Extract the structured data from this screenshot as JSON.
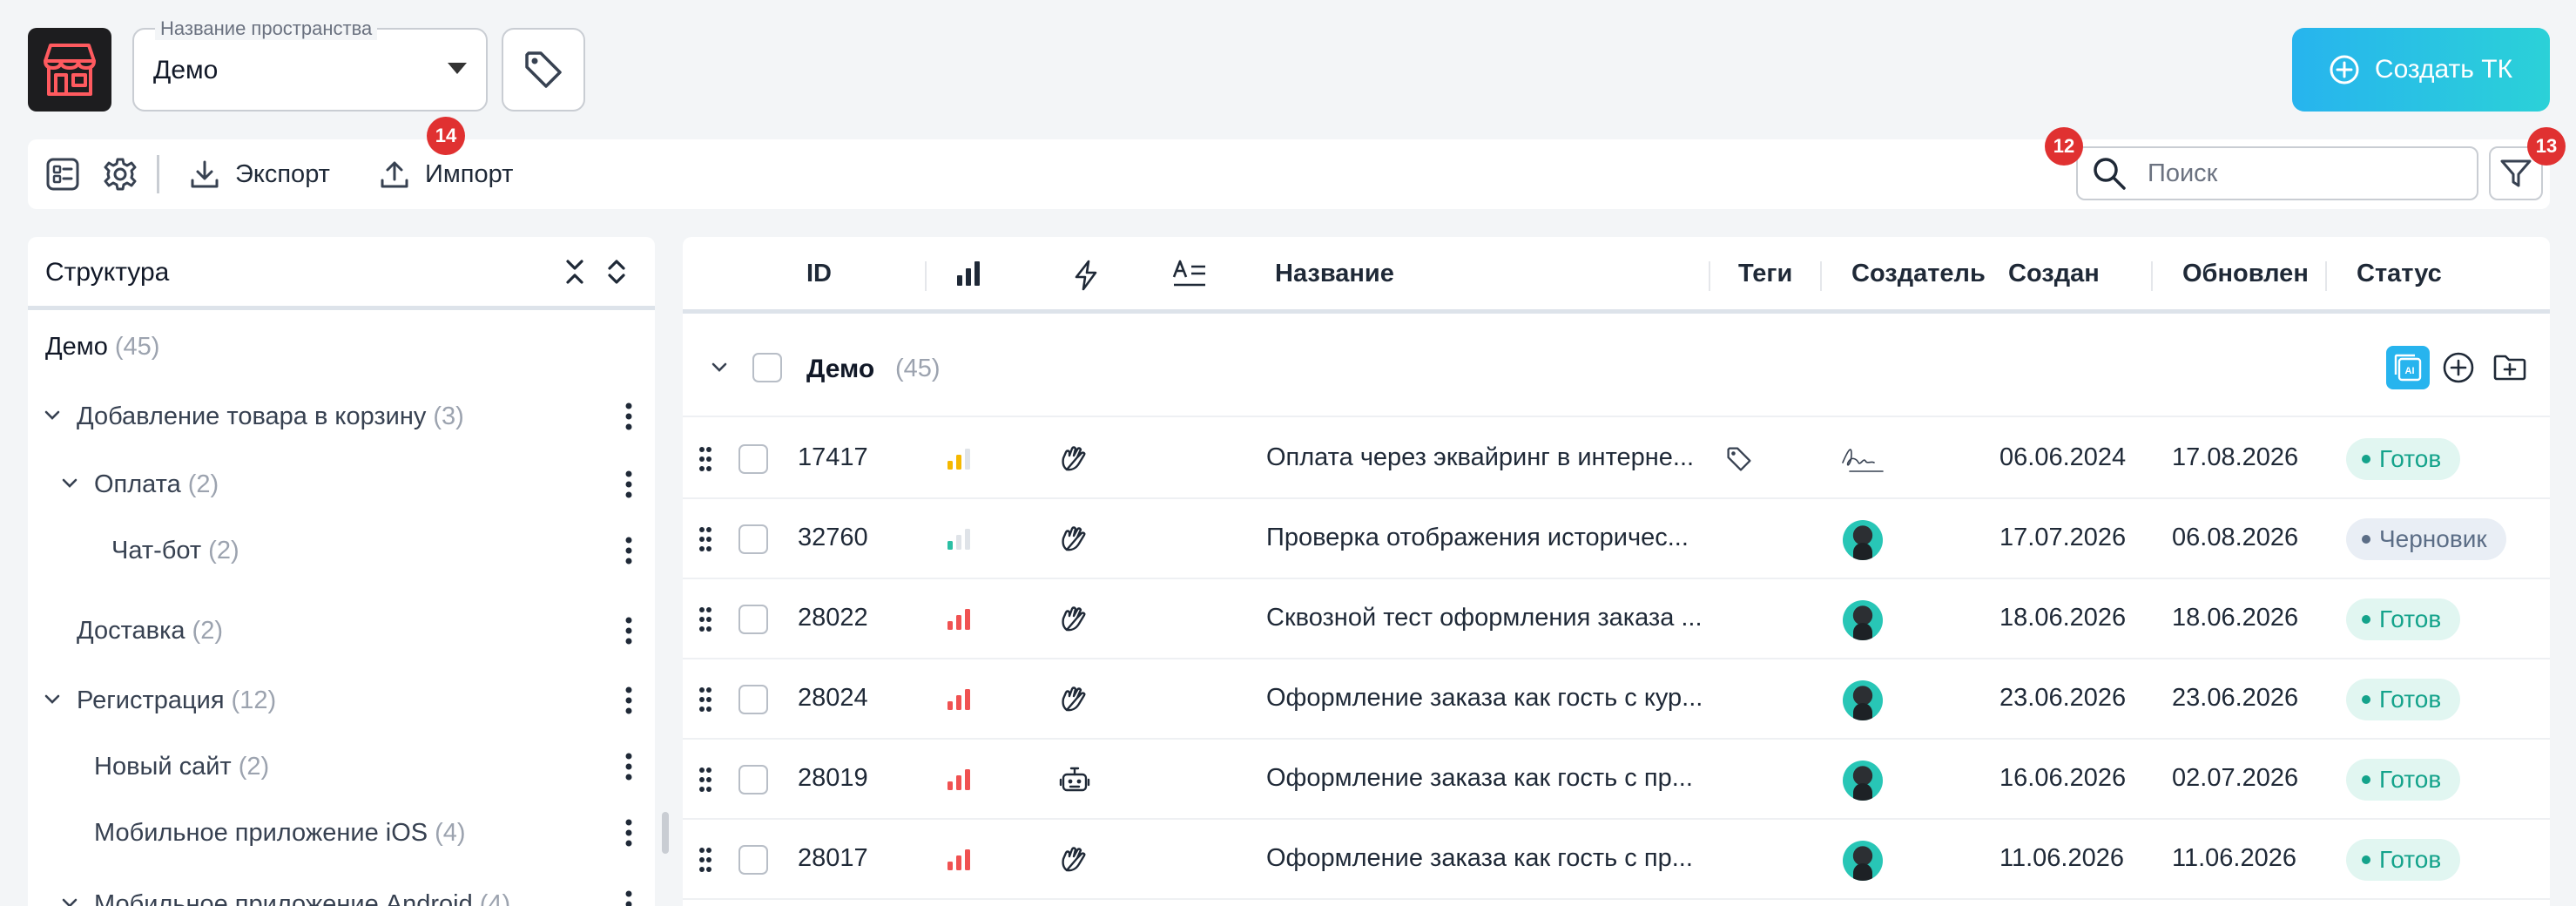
{
  "header": {
    "space_label": "Название пространства",
    "space_value": "Демо",
    "create_label": "Создать ТК",
    "logo_icon": "store-icon"
  },
  "toolbar": {
    "export_label": "Экспорт",
    "import_label": "Импорт",
    "import_badge": "14",
    "search_badge": "12",
    "filter_badge": "13",
    "search_placeholder": "Поиск"
  },
  "structure": {
    "title": "Структура",
    "root": {
      "label": "Демо",
      "count": "(45)"
    },
    "items": [
      {
        "label": "Добавление товара в корзину",
        "count": "(3)",
        "expanded": true
      },
      {
        "label": "Оплата",
        "count": "(2)",
        "expanded": true
      },
      {
        "label": "Чат-бот",
        "count": "(2)"
      },
      {
        "label": "Доставка",
        "count": "(2)"
      },
      {
        "label": "Регистрация",
        "count": "(12)",
        "expanded": true
      },
      {
        "label": "Новый сайт",
        "count": "(2)"
      },
      {
        "label": "Мобильное приложение iOS",
        "count": "(4)"
      },
      {
        "label": "Мобильное приложение Android",
        "count": "(4)",
        "expanded": true
      }
    ]
  },
  "table": {
    "columns": {
      "id": "ID",
      "name": "Название",
      "tags": "Теги",
      "creator": "Создатель",
      "created": "Создан",
      "updated": "Обновлен",
      "status": "Статус"
    },
    "group": {
      "name": "Демо",
      "count": "(45)"
    },
    "rows": [
      {
        "id": "17417",
        "priority": "medium",
        "type": "manual",
        "title": "Оплата через эквайринг в интерне...",
        "has_tag": true,
        "creator": "signature",
        "created": "06.06.2024",
        "updated": "17.08.2026",
        "status": "Готов",
        "status_kind": "ready"
      },
      {
        "id": "32760",
        "priority": "low",
        "type": "manual",
        "title": "Проверка отображения историчес...",
        "has_tag": false,
        "creator": "avatar",
        "created": "17.07.2026",
        "updated": "06.08.2026",
        "status": "Черновик",
        "status_kind": "draft"
      },
      {
        "id": "28022",
        "priority": "high",
        "type": "manual",
        "title": "Сквозной тест оформления заказа ...",
        "has_tag": false,
        "creator": "avatar",
        "created": "18.06.2026",
        "updated": "18.06.2026",
        "status": "Готов",
        "status_kind": "ready"
      },
      {
        "id": "28024",
        "priority": "high",
        "type": "manual",
        "title": "Оформление заказа как гость с кур...",
        "has_tag": false,
        "creator": "avatar",
        "created": "23.06.2026",
        "updated": "23.06.2026",
        "status": "Готов",
        "status_kind": "ready"
      },
      {
        "id": "28019",
        "priority": "high",
        "type": "automated",
        "title": "Оформление заказа как гость с пр...",
        "has_tag": false,
        "creator": "avatar",
        "created": "16.06.2026",
        "updated": "02.07.2026",
        "status": "Готов",
        "status_kind": "ready"
      },
      {
        "id": "28017",
        "priority": "high",
        "type": "manual",
        "title": "Оформление заказа как гость с пр...",
        "has_tag": false,
        "creator": "avatar",
        "created": "11.06.2026",
        "updated": "11.06.2026",
        "status": "Готов",
        "status_kind": "ready"
      }
    ]
  },
  "colors": {
    "accent": "#27b4ee",
    "badge": "#e03131",
    "ready": "#14a38b",
    "draft": "#5b6d86",
    "priority_high": "#f05252",
    "priority_medium": "#f5b800",
    "priority_low": "#2bbfa4"
  }
}
